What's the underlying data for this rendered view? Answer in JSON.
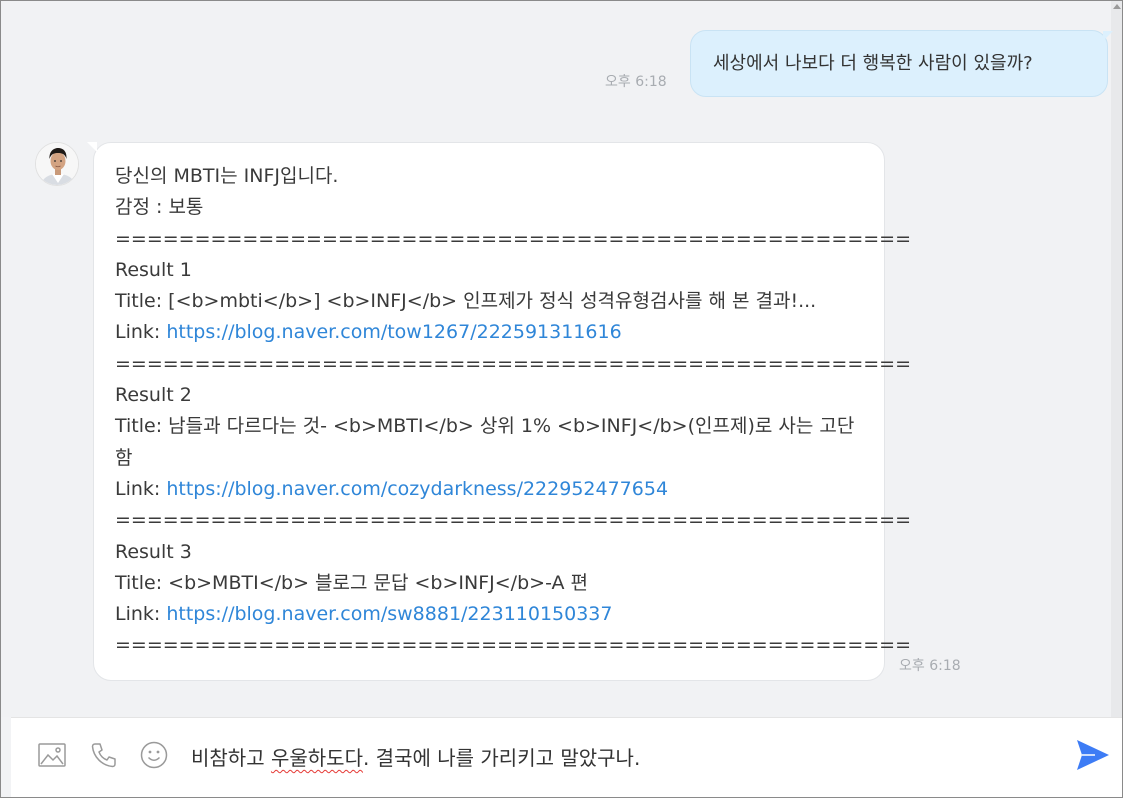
{
  "messages": {
    "outgoing": {
      "text": "세상에서 나보다 더 행복한 사람이 있을까?",
      "time": "오후 6:18"
    },
    "incoming": {
      "avatar": "user-avatar-photo",
      "lines": [
        "당신의 MBTI는 INFJ입니다.",
        "감정 : 보통",
        "==================================================",
        "Result 1",
        "Title: [<b>mbti</b>] <b>INFJ</b> 인프제가 정식 성격유형검사를 해 본 결과!...",
        "==================================================",
        "Result 2",
        "Title: 남들과 다르다는 것- <b>MBTI</b> 상위 1% <b>INFJ</b>(인프제)로 사는 고단함",
        "==================================================",
        "Result 3",
        "Title: <b>MBTI</b> 블로그 문답 <b>INFJ</b>-A 편",
        "=================================================="
      ],
      "link_label": "Link: ",
      "links": [
        "https://blog.naver.com/tow1267/222591311616",
        "https://blog.naver.com/cozydarkness/222952477654",
        "https://blog.naver.com/sw8881/223110150337"
      ],
      "time": "오후 6:18"
    }
  },
  "input": {
    "text_before": "비참하고 ",
    "text_misspelled": "우울하도다",
    "text_after": ". 결국에 나를 가리키고 말았구나.",
    "icons": [
      "image-icon",
      "phone-icon",
      "emoji-icon",
      "send-icon"
    ]
  },
  "colors": {
    "outgoing_bubble": "#dcf0fd",
    "link": "#2f86d8",
    "send": "#3d7cf5"
  }
}
